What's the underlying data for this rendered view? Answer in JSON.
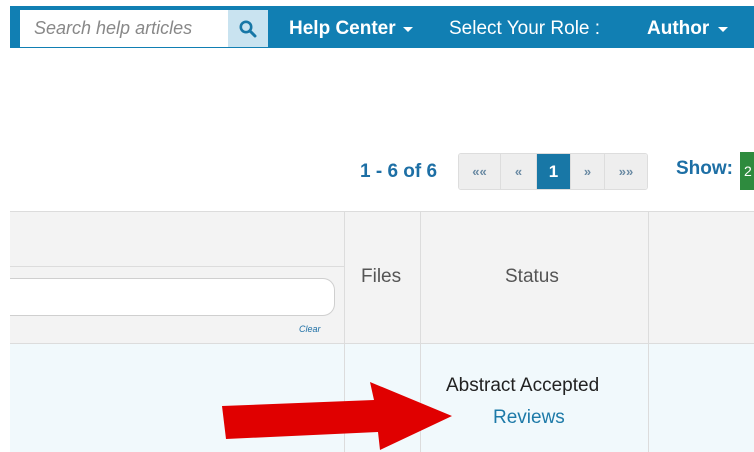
{
  "header": {
    "search_placeholder": "Search help articles",
    "help_center_label": "Help Center",
    "select_role_label": "Select Your Role :",
    "role_value": "Author"
  },
  "pagination": {
    "range_text": "1 - 6 of 6",
    "first_label": "««",
    "prev_label": "«",
    "current_page": "1",
    "next_label": "»",
    "last_label": "»»",
    "show_label": "Show:",
    "show_value": "2"
  },
  "table": {
    "filter_clear_label": "Clear",
    "columns": {
      "files": "Files",
      "status": "Status"
    },
    "rows": [
      {
        "status": "Abstract Accepted",
        "action_link": "Reviews"
      }
    ]
  },
  "colors": {
    "topbar": "#117fb3",
    "link": "#1d6fa5",
    "arrow": "#e00000",
    "show_badge": "#2e8b3e"
  }
}
